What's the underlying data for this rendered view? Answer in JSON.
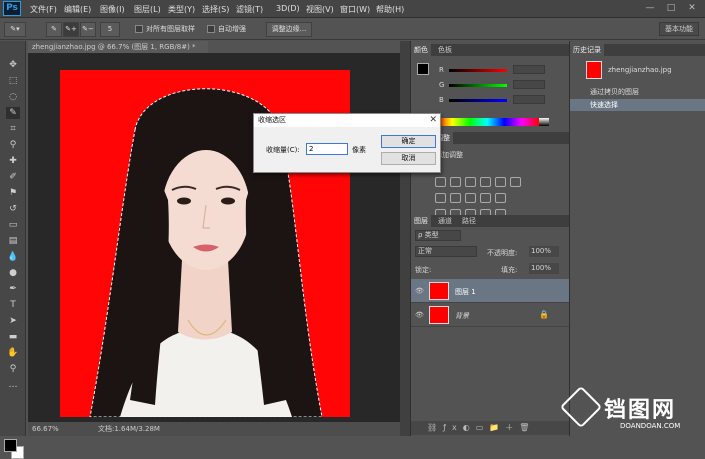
{
  "app": {
    "logo": "Ps"
  },
  "menu": [
    "文件(F)",
    "编辑(E)",
    "图像(I)",
    "图层(L)",
    "类型(Y)",
    "选择(S)",
    "滤镜(T)",
    "3D(D)",
    "视图(V)",
    "窗口(W)",
    "帮助(H)"
  ],
  "window_buttons": [
    "—",
    "□",
    "✕"
  ],
  "options": {
    "sample_all_layers": "对所有图层取样",
    "auto_enhance": "自动增强",
    "refine_edge": "调整边缘...",
    "essentials": "基本功能",
    "brush_size": "5"
  },
  "document": {
    "tab": "zhengjianzhao.jpg @ 66.7% (图层 1, RGB/8#) *",
    "zoom": "66.67%",
    "doc_info": "文档:1.64M/3.28M"
  },
  "color_panel": {
    "tabs": [
      "颜色",
      "色板"
    ],
    "channels": [
      "R",
      "G",
      "B"
    ],
    "values": [
      "",
      "",
      ""
    ]
  },
  "adjust_panel": {
    "tab": "调整",
    "title": "添加调整"
  },
  "layers_panel": {
    "tabs": [
      "图层",
      "通道",
      "路径"
    ],
    "kind": "ρ 类型",
    "blend": "正常",
    "opacity_label": "不透明度:",
    "opacity": "100%",
    "lock_label": "锁定:",
    "fill_label": "填充:",
    "fill": "100%",
    "layers": [
      {
        "name": "图层 1",
        "italic": false
      },
      {
        "name": "背景",
        "italic": true
      }
    ]
  },
  "history_panel": {
    "tab": "历史记录",
    "snapshot": "zhengjianzhao.jpg",
    "steps": [
      "通过拷贝的图层",
      "快速选择"
    ]
  },
  "dialog": {
    "title": "收缩选区",
    "label": "收缩量(C):",
    "value": "2",
    "unit": "像素",
    "ok": "确定",
    "cancel": "取消"
  },
  "watermark": {
    "text": "铛图网",
    "sub": "DOANDOAN.COM"
  },
  "colors": {
    "accent": "#3b78d8",
    "canvas_bg": "#ff0505",
    "panel": "#535353"
  }
}
